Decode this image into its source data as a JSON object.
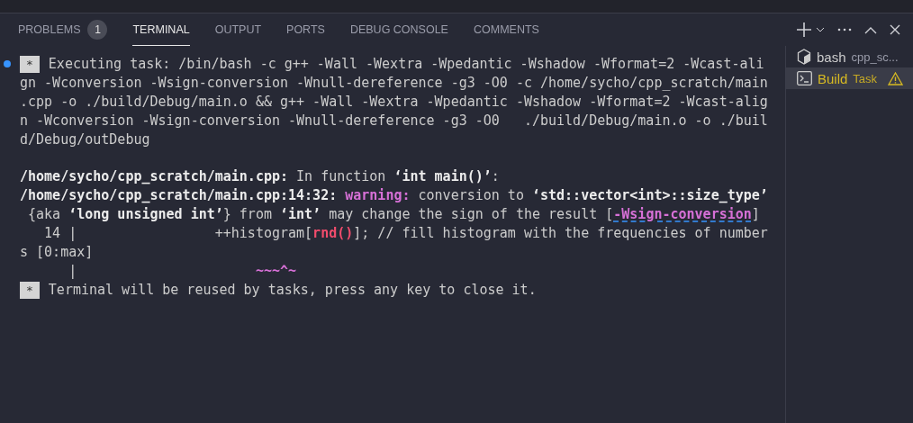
{
  "tabs": [
    {
      "label": "PROBLEMS",
      "badge": "1",
      "selected": false
    },
    {
      "label": "TERMINAL",
      "selected": true
    },
    {
      "label": "OUTPUT",
      "selected": false
    },
    {
      "label": "PORTS",
      "selected": false
    },
    {
      "label": "DEBUG CONSOLE",
      "selected": false
    },
    {
      "label": "COMMENTS",
      "selected": false
    }
  ],
  "terminal": {
    "lines": [
      {
        "marker": "*",
        "segments": [
          {
            "kind": "plain",
            "text": "Executing task: /bin/bash -c g++ -Wall -Wextra -Wpedantic -Wshadow -Wformat=2 -Wcast-ali"
          }
        ]
      },
      {
        "segments": [
          {
            "kind": "plain",
            "text": "gn -Wconversion -Wsign-conversion -Wnull-dereference -g3 -O0 -c /home/sycho/cpp_scratch/main"
          }
        ]
      },
      {
        "segments": [
          {
            "kind": "plain",
            "text": ".cpp -o ./build/Debug/main.o && g++ -Wall -Wextra -Wpedantic -Wshadow -Wformat=2 -Wcast-alig"
          }
        ]
      },
      {
        "segments": [
          {
            "kind": "plain",
            "text": "n -Wconversion -Wsign-conversion -Wnull-dereference -g3 -O0   ./build/Debug/main.o -o ./buil"
          }
        ]
      },
      {
        "segments": [
          {
            "kind": "plain",
            "text": "d/Debug/outDebug"
          }
        ]
      },
      {
        "gap_before": true,
        "segments": [
          {
            "kind": "bold",
            "text": "/home/sycho/cpp_scratch/main.cpp:"
          },
          {
            "kind": "plain",
            "text": " In function "
          },
          {
            "kind": "bold",
            "text": "‘int main()’"
          },
          {
            "kind": "plain",
            "text": ":"
          }
        ]
      },
      {
        "segments": [
          {
            "kind": "bold",
            "text": "/home/sycho/cpp_scratch/main.cpp:14:32: "
          },
          {
            "kind": "warning",
            "text": "warning:"
          },
          {
            "kind": "plain",
            "text": " conversion to "
          },
          {
            "kind": "bold",
            "text": "‘std::vector<int>::size_type’"
          }
        ]
      },
      {
        "segments": [
          {
            "kind": "plain",
            "text": " {aka "
          },
          {
            "kind": "bold",
            "text": "‘long unsigned int’"
          },
          {
            "kind": "plain",
            "text": "} from "
          },
          {
            "kind": "bold",
            "text": "‘int’"
          },
          {
            "kind": "plain",
            "text": " may change the sign of the result ["
          },
          {
            "kind": "flag",
            "text": "-Wsign-conversion"
          },
          {
            "kind": "plain",
            "text": "]"
          }
        ]
      },
      {
        "segments": [
          {
            "kind": "plain",
            "text": "   14 |                 ++histogram["
          },
          {
            "kind": "error",
            "text": "rnd()"
          },
          {
            "kind": "plain",
            "text": "]; // fill histogram with the frequencies of number"
          }
        ]
      },
      {
        "segments": [
          {
            "kind": "plain",
            "text": "s [0:max]"
          }
        ]
      },
      {
        "segments": [
          {
            "kind": "plain",
            "text": "      |                      "
          },
          {
            "kind": "warning",
            "text": "~~~^~"
          }
        ]
      },
      {
        "marker": "*",
        "segments": [
          {
            "kind": "plain",
            "text": "Terminal will be reused by tasks, press any key to close it."
          }
        ]
      }
    ]
  },
  "terminals": [
    {
      "name": "bash",
      "detail": "cpp_sc...",
      "kind": "shell",
      "selected": false,
      "warning": false
    },
    {
      "name": "Build",
      "detail": "Task",
      "kind": "task",
      "selected": true,
      "warning": true
    }
  ]
}
